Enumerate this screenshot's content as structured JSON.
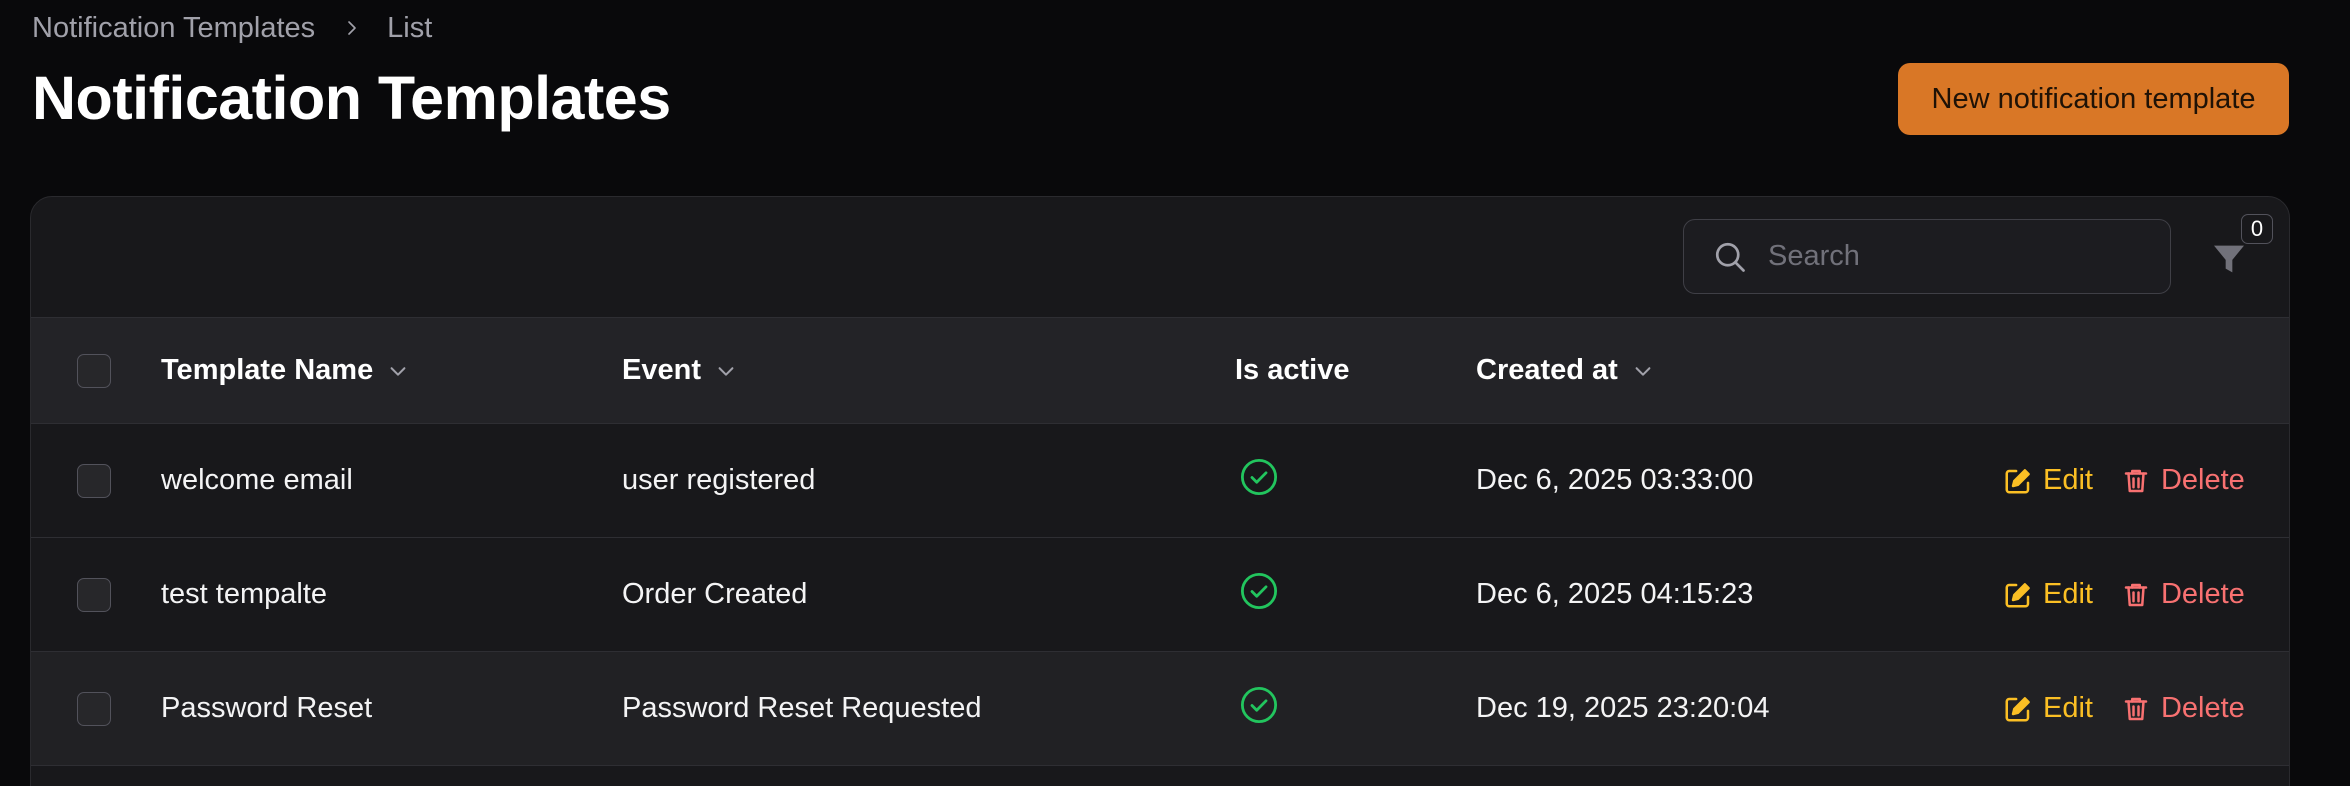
{
  "breadcrumb": {
    "items": [
      "Notification Templates",
      "List"
    ]
  },
  "page": {
    "title": "Notification Templates",
    "new_button_label": "New notification template"
  },
  "toolbar": {
    "search_placeholder": "Search",
    "search_value": "",
    "filter_count": "0"
  },
  "table": {
    "columns": {
      "template_name": "Template Name",
      "event": "Event",
      "is_active": "Is active",
      "created_at": "Created at"
    },
    "rows": [
      {
        "template_name": "welcome email",
        "event": "user registered",
        "is_active": true,
        "created_at": "Dec 6, 2025 03:33:00",
        "edit_label": "Edit",
        "delete_label": "Delete"
      },
      {
        "template_name": "test tempalte",
        "event": "Order Created",
        "is_active": true,
        "created_at": "Dec 6, 2025 04:15:23",
        "edit_label": "Edit",
        "delete_label": "Delete"
      },
      {
        "template_name": "Password Reset",
        "event": "Password Reset Requested",
        "is_active": true,
        "created_at": "Dec 19, 2025 23:20:04",
        "edit_label": "Edit",
        "delete_label": "Delete"
      }
    ]
  },
  "icons": {
    "breadcrumb_separator": "chevron-right-icon",
    "sort": "chevron-down-icon",
    "search": "search-icon",
    "filter": "filter-icon",
    "active": "check-circle-icon",
    "edit": "pencil-square-icon",
    "delete": "trash-icon"
  },
  "colors": {
    "background": "#09090b",
    "card": "#18181b",
    "accent": "#d97726",
    "edit": "#fbbf24",
    "delete": "#f87171",
    "active": "#22c55e"
  }
}
